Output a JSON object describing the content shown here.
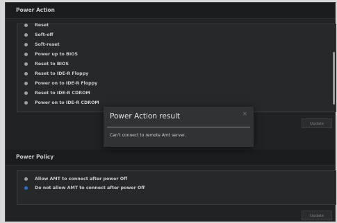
{
  "power_action": {
    "title": "Power Action",
    "options": [
      {
        "label": "Reset",
        "selected": false
      },
      {
        "label": "Soft-off",
        "selected": false
      },
      {
        "label": "Soft-reset",
        "selected": false
      },
      {
        "label": "Power up to BIOS",
        "selected": false
      },
      {
        "label": "Reset to BIOS",
        "selected": false
      },
      {
        "label": "Reset to IDE-R Floppy",
        "selected": false
      },
      {
        "label": "Power on to IDE-R Floppy",
        "selected": false
      },
      {
        "label": "Reset to IDE-R CDROM",
        "selected": false
      },
      {
        "label": "Power on to IDE-R CDROM",
        "selected": false
      }
    ],
    "update_label": "Update"
  },
  "power_policy": {
    "title": "Power Policy",
    "options": [
      {
        "label": "Allow AMT to connect after power Off",
        "selected": false
      },
      {
        "label": "Do not allow AMT to connect after power Off",
        "selected": true
      }
    ],
    "update_label": "Update"
  },
  "dialog": {
    "title": "Power Action result",
    "close_glyph": "×",
    "message": "Can't connect to remote Amt server."
  },
  "colors": {
    "selected_radio": "#2a6cc8",
    "unselected_radio": "#9aa0a4",
    "background": "#202224"
  }
}
